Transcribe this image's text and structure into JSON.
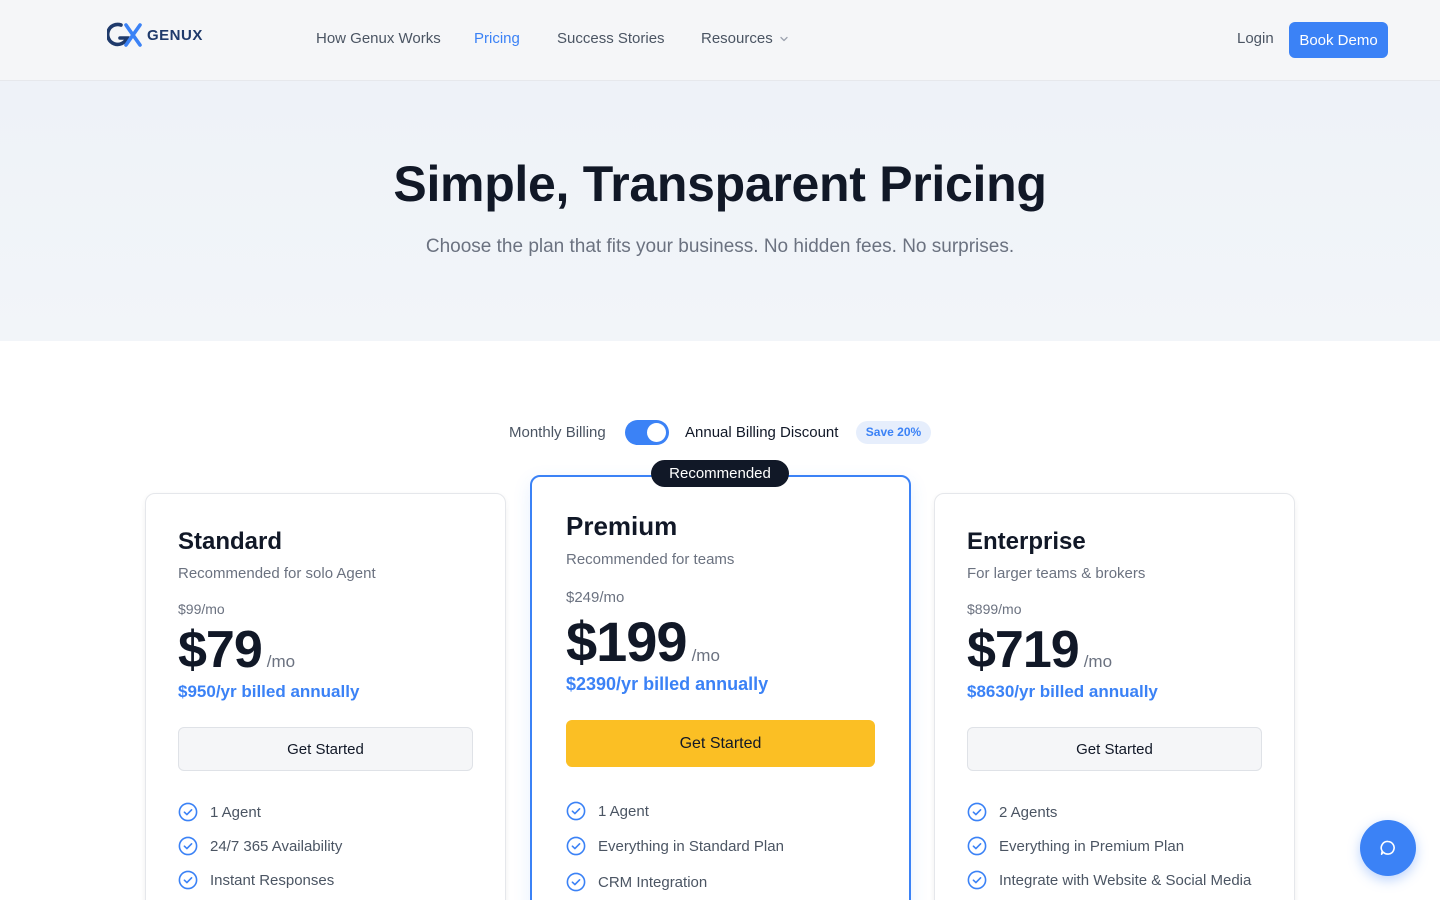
{
  "brand": {
    "name": "GENUX",
    "accent": "#3b82f6",
    "dark": "#111827",
    "cta_yellow": "#fbbf24"
  },
  "nav": {
    "items": [
      {
        "label": "How Genux Works",
        "active": false
      },
      {
        "label": "Pricing",
        "active": true
      },
      {
        "label": "Success Stories",
        "active": false
      },
      {
        "label": "Resources",
        "active": false,
        "icon": "chevron-down-icon"
      }
    ],
    "login": "Login",
    "book_demo": "Book Demo"
  },
  "hero": {
    "title": "Simple, Transparent Pricing",
    "subtitle": "Choose the plan that fits your business. No hidden fees. No surprises."
  },
  "billing": {
    "monthly_label": "Monthly Billing",
    "annual_label": "Annual Billing Discount",
    "annual_selected": true,
    "save_badge": "Save 20%"
  },
  "plans": [
    {
      "name": "Standard",
      "subtitle": "Recommended for solo Agent",
      "old_price": "$99/mo",
      "price": "$79",
      "period": "/mo",
      "annual": "$950/yr billed annually",
      "cta": "Get Started",
      "features": [
        "1 Agent",
        "24/7 365 Availability",
        "Instant Responses"
      ]
    },
    {
      "name": "Premium",
      "badge": "Recommended",
      "subtitle": "Recommended for teams",
      "old_price": "$249/mo",
      "price": "$199",
      "period": "/mo",
      "annual": "$2390/yr billed annually",
      "cta": "Get Started",
      "features": [
        "1 Agent",
        "Everything in Standard Plan",
        "CRM Integration"
      ]
    },
    {
      "name": "Enterprise",
      "subtitle": "For larger teams & brokers",
      "old_price": "$899/mo",
      "price": "$719",
      "period": "/mo",
      "annual": "$8630/yr billed annually",
      "cta": "Get Started",
      "features": [
        "2 Agents",
        "Everything in Premium Plan",
        "Integrate with Website & Social Media"
      ]
    }
  ],
  "chat": {
    "icon": "chat-bubble-icon"
  }
}
